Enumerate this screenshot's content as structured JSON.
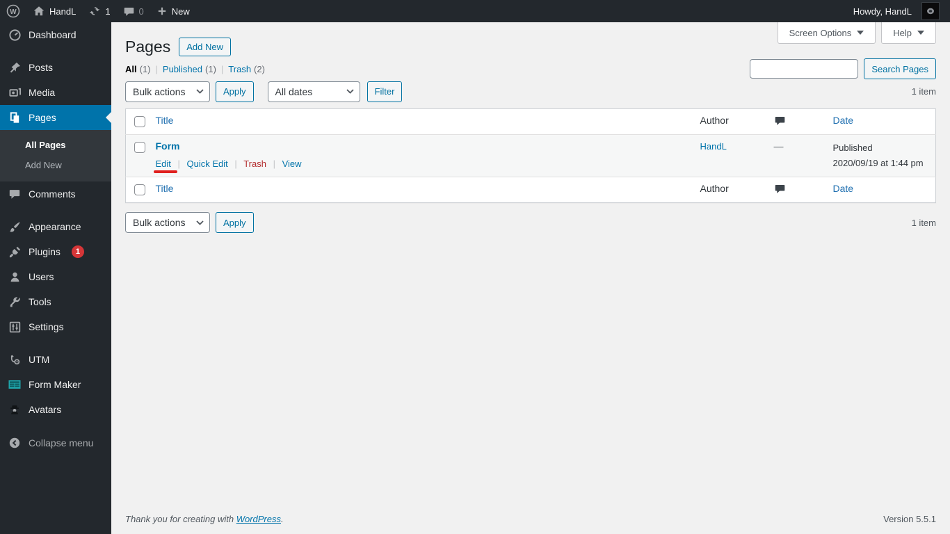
{
  "admin_bar": {
    "site_name": "HandL",
    "update_count": "1",
    "comment_count": "0",
    "new_label": "New",
    "howdy": "Howdy, HandL"
  },
  "sidebar": {
    "dashboard": "Dashboard",
    "posts": "Posts",
    "media": "Media",
    "pages": "Pages",
    "all_pages": "All Pages",
    "add_new": "Add New",
    "comments": "Comments",
    "appearance": "Appearance",
    "plugins": "Plugins",
    "plugins_badge": "1",
    "users": "Users",
    "tools": "Tools",
    "settings": "Settings",
    "utm": "UTM",
    "form_maker": "Form Maker",
    "avatars": "Avatars",
    "collapse": "Collapse menu"
  },
  "screen_meta": {
    "screen_options_label": "Screen Options",
    "help_label": "Help"
  },
  "page": {
    "title": "Pages",
    "add_new_label": "Add New",
    "filters": [
      {
        "label": "All",
        "count": "(1)"
      },
      {
        "label": "Published",
        "count": "(1)"
      },
      {
        "label": "Trash",
        "count": "(2)"
      }
    ],
    "bulk_actions_label": "Bulk actions",
    "apply_label": "Apply",
    "all_dates_label": "All dates",
    "filter_label": "Filter",
    "search_button_label": "Search Pages",
    "item_count": "1 item"
  },
  "table": {
    "columns": {
      "title": "Title",
      "author": "Author",
      "date": "Date"
    },
    "row": {
      "title": "Form",
      "actions": {
        "edit": "Edit",
        "quick_edit": "Quick Edit",
        "trash": "Trash",
        "view": "View"
      },
      "author": "HandL",
      "comments": "—",
      "status": "Published",
      "date": "2020/09/19 at 1:44 pm"
    }
  },
  "footer": {
    "thanks_text": "Thank you for creating with",
    "wordpress_link": "WordPress",
    "period": ".",
    "version": "Version 5.5.1"
  },
  "colors": {
    "admin_dark": "#23282d",
    "submenu_dark": "#32373c",
    "menu_highlight": "#0073aa",
    "link_blue": "#0073aa",
    "button_blue": "#0071a1",
    "badge_red": "#d63638",
    "trash_red": "#b32d2e",
    "annotation_red": "#e0201e",
    "form_maker_teal": "#1fa7ad",
    "content_bg": "#f1f1f1",
    "row_stripe": "#f6f7f7"
  }
}
